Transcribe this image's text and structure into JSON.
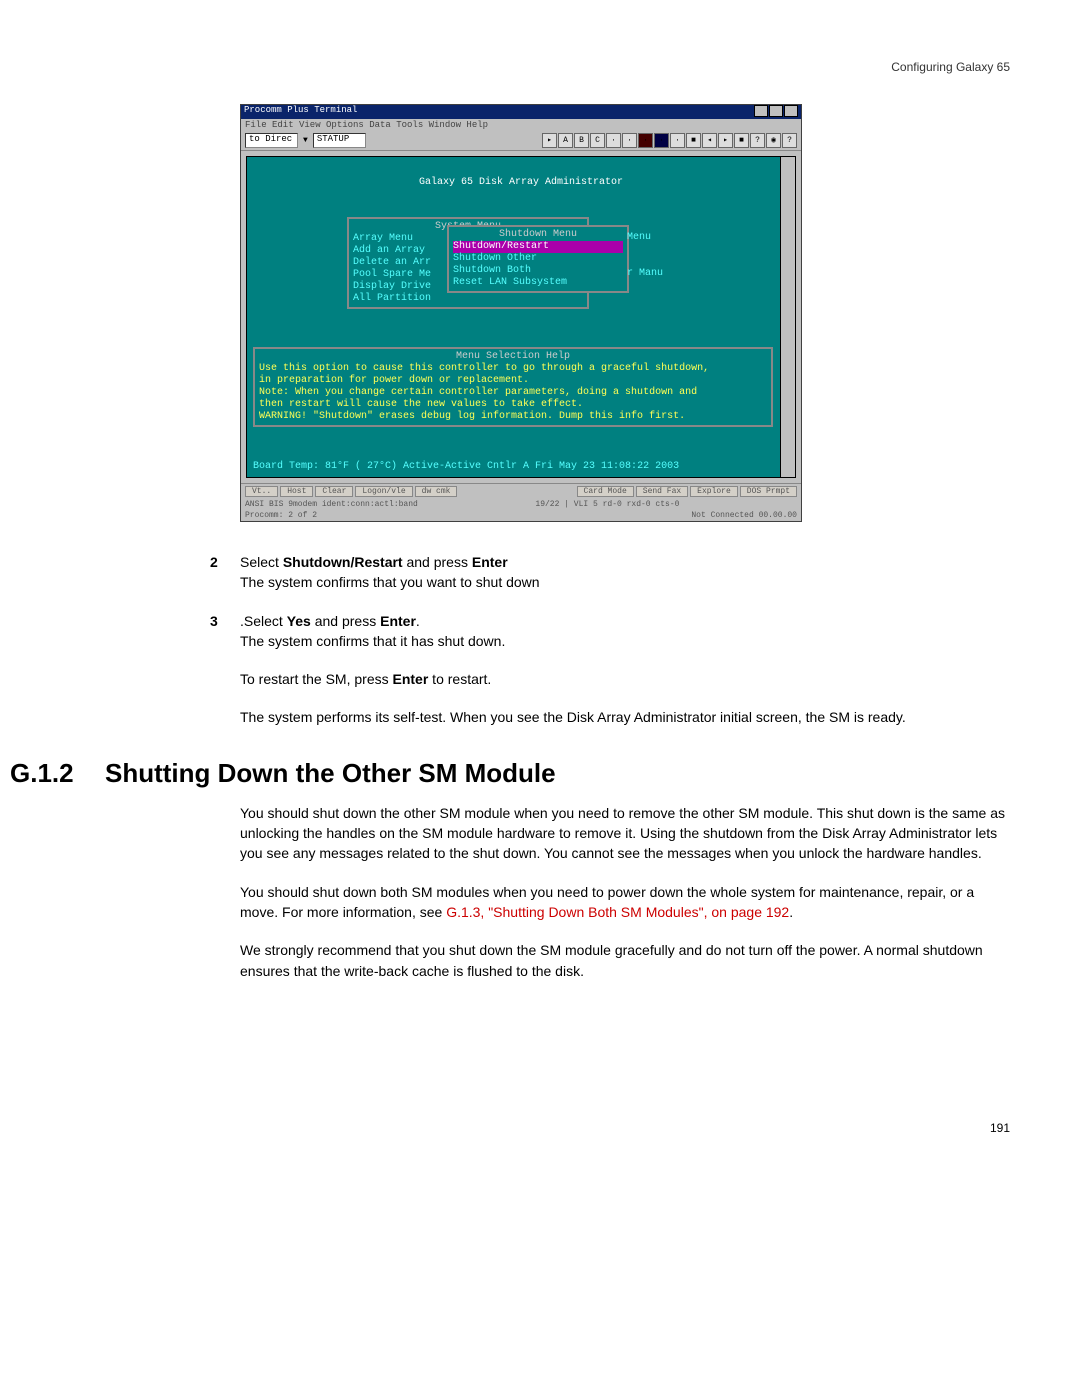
{
  "header": {
    "right": "Configuring Galaxy 65"
  },
  "terminal": {
    "title": "Procomm Plus Terminal",
    "menu": "File  Edit  View  Options  Data  Tools  Window  Help",
    "field1": "to Direc",
    "field2": "STATUP",
    "admin_title": "Galaxy 65 Disk Array Administrator",
    "system_menu_label": "System Menu",
    "system_menu_items": [
      "Array Menu",
      "Add an Array",
      "Delete an Arr",
      "Pool Spare Me",
      "Display Drive",
      "All Partition"
    ],
    "shutdown_label": "Shutdown Menu",
    "shutdown_items": [
      "Shutdown/Restart",
      "Shutdown Other",
      "Shutdown Both",
      "Reset LAN Subsystem"
    ],
    "side_items": [
      "Menu",
      "",
      "",
      "r Manu"
    ],
    "help_label": "Menu Selection Help",
    "help_lines": [
      "Use this option to cause this controller to go through a graceful shutdown,",
      "in preparation for power down or replacement.",
      "Note:  When you change certain controller parameters, doing a shutdown and",
      "then restart will cause the new values to take effect.",
      "WARNING!  \"Shutdown\" erases debug log information.  Dump this info first."
    ],
    "status": "Board Temp:  81°F ( 27°C)   Active-Active    Cntlr A    Fri May 23 11:08:22 2003",
    "tabs": [
      "Vt..",
      "Host",
      "Clear",
      "Logon/vle",
      "dw cmk",
      "",
      "Card Mode",
      "Send Fax",
      "Explore",
      "DOS Prmpt"
    ],
    "bot_left": "ANSI BIS   9modem  ident:conn:actl:band",
    "bot_mid": "19/22  | VLI 5  rd-0  rxd-0 cts-0",
    "bot_right": "Not Connected    00.00.00",
    "bot_left2": "Procomm: 2 of 2"
  },
  "steps": {
    "s2_num": "2",
    "s2_a": "Select ",
    "s2_b": "Shutdown/Restart",
    "s2_c": " and press ",
    "s2_d": "Enter",
    "s2_line2": "The system confirms that you want to shut down",
    "s3_num": "3",
    "s3_a": ".Select ",
    "s3_b": "Yes",
    "s3_c": " and press ",
    "s3_d": "Enter",
    "s3_e": ".",
    "s3_line2": "The system confirms that it has shut down.",
    "p4_a": "To restart the SM, press ",
    "p4_b": "Enter",
    "p4_c": " to restart.",
    "p5": "The system performs its self-test. When you see the Disk Array Administrator initial screen, the SM is ready."
  },
  "section": {
    "num": "G.1.2",
    "title": "Shutting Down the Other SM Module",
    "p1": "You should shut down the other SM module when you need to remove the other SM module. This shut down is the same as unlocking the handles on the SM module hardware to remove it. Using the shutdown from the Disk Array Administrator lets you see any messages related to the shut down. You cannot see the messages when you unlock the hardware handles.",
    "p2a": "You should shut down both SM modules when you need to power down the whole system for maintenance, repair, or a move. For more information, see ",
    "p2link": "G.1.3, \"Shutting Down Both SM Modules\", on page 192",
    "p2b": ".",
    "p3": "We strongly recommend that you shut down the SM module gracefully and do not turn off the power. A normal shutdown ensures that the write-back cache is flushed to the disk."
  },
  "footer": {
    "page": "191"
  }
}
